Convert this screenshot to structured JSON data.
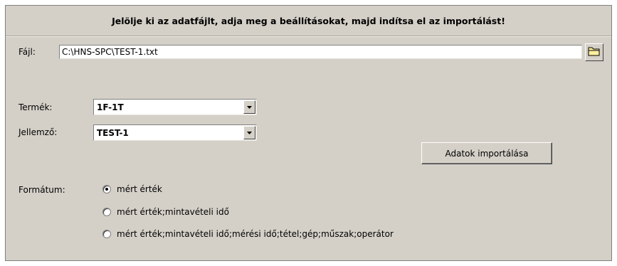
{
  "header": {
    "instruction": "Jelölje ki az adatfájlt, adja meg a beállításokat, majd indítsa el az importálást!"
  },
  "file": {
    "label": "Fájl:",
    "value": "C:\\HNS-SPC\\TEST-1.txt",
    "browse_icon": "folder-icon"
  },
  "product": {
    "label": "Termék:",
    "selected": "1F-1T"
  },
  "characteristic": {
    "label": "Jellemző:",
    "selected": "TEST-1"
  },
  "import_button": {
    "label": "Adatok importálása"
  },
  "format": {
    "label": "Formátum:",
    "options": [
      {
        "label": "mért érték",
        "checked": true
      },
      {
        "label": "mért érték;mintavételi idő",
        "checked": false
      },
      {
        "label": "mért érték;mintavételi idő;mérési idő;tétel;gép;műszak;operátor",
        "checked": false
      }
    ]
  }
}
